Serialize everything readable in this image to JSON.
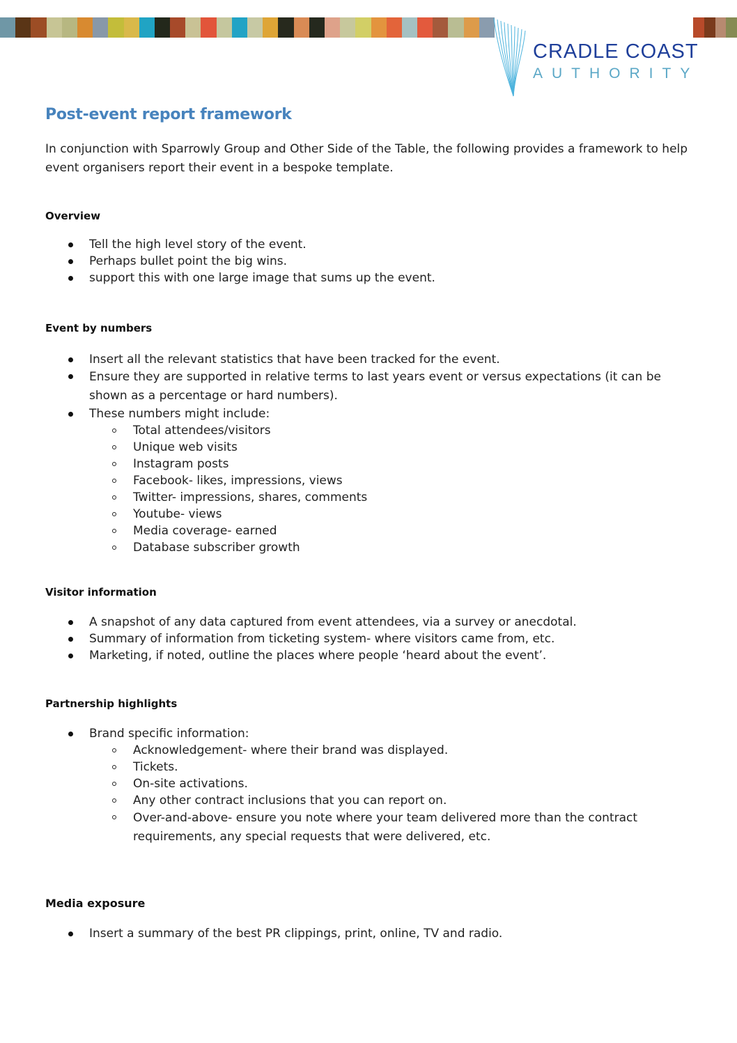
{
  "header": {
    "band_colors_left": [
      "#6f97a6",
      "#5a3516",
      "#9c4d25",
      "#c7c595",
      "#b7b781",
      "#d88a30",
      "#8898a8",
      "#c3bd3a",
      "#d9b94a",
      "#20a4c4",
      "#23281b",
      "#a74a2a",
      "#c9c295",
      "#e2553a",
      "#c5c79e",
      "#22a3c5",
      "#c7c9a4",
      "#dea536",
      "#27291d",
      "#d98b55",
      "#25291e",
      "#dea28a",
      "#c7c89c",
      "#d2cf66",
      "#e3943e",
      "#e3643a",
      "#a5c1c2",
      "#e35a3d",
      "#a45a3c",
      "#b9bd93",
      "#dd9b4a",
      "#8a9cae"
    ],
    "band_colors_right": [
      "#b84a2a",
      "#7a3a1c",
      "#b78a70",
      "#868b54"
    ],
    "logo": {
      "title": "CRADLE COAST",
      "subtitle": "AUTHORITY",
      "title_color": "#1f3f9a",
      "subtitle_color": "#5aa7c6",
      "icon": "fan-lines-icon"
    }
  },
  "document": {
    "title": "Post-event report framework",
    "title_color": "#4783bd",
    "intro": "In conjunction with Sparrowly Group and Other Side of the Table, the following provides a framework to help event organisers report their event in a bespoke template.",
    "sections": [
      {
        "heading": "Overview",
        "items": [
          {
            "text": "Tell the high level story of the event."
          },
          {
            "text": "Perhaps bullet point the big wins."
          },
          {
            "text": "support this with one large image that sums up the event."
          }
        ]
      },
      {
        "heading": "Event by numbers",
        "items": [
          {
            "text": "Insert all the relevant statistics that have been tracked for the event."
          },
          {
            "text": "Ensure they are supported in relative terms to last years event or versus expectations (it can be shown as a percentage or hard numbers)."
          },
          {
            "text": "These numbers might include:",
            "subitems": [
              "Total attendees/visitors",
              "Unique web visits",
              "Instagram posts",
              "Facebook- likes, impressions, views",
              "Twitter- impressions, shares, comments",
              "Youtube- views",
              "Media coverage- earned",
              "Database subscriber growth"
            ]
          }
        ]
      },
      {
        "heading": "Visitor information",
        "items": [
          {
            "text": "A snapshot of any data captured from event attendees, via a survey or anecdotal."
          },
          {
            "text": "Summary of information from ticketing system- where visitors came from, etc."
          },
          {
            "text": "Marketing, if noted, outline the places where people ‘heard about the event’."
          }
        ]
      },
      {
        "heading": "Partnership highlights",
        "items": [
          {
            "text": "Brand specific information:",
            "subitems": [
              "Acknowledgement- where their brand was displayed.",
              "Tickets.",
              "On-site activations.",
              "Any other contract inclusions that you can report on.",
              "Over-and-above- ensure you note where your team delivered more than the contract requirements, any special requests that were delivered, etc."
            ]
          }
        ]
      },
      {
        "heading": "Media exposure",
        "items": [
          {
            "text": "Insert a summary of the best PR clippings, print, online, TV and radio."
          }
        ]
      }
    ]
  }
}
